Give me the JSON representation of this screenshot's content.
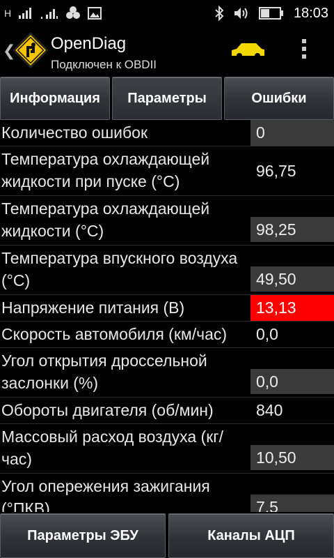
{
  "status_bar": {
    "left_indicator_text": "H",
    "time": "18:03"
  },
  "app_bar": {
    "title": "OpenDiag",
    "subtitle": "Подключен к OBDII",
    "car_color": "#f3d800"
  },
  "tabs": [
    {
      "label": "Информация"
    },
    {
      "label": "Параметры"
    },
    {
      "label": "Ошибки"
    }
  ],
  "params": [
    {
      "label": "Количество ошибок",
      "value": "0"
    },
    {
      "label": "Температура охлаждающей жидкости при пуске (°C)",
      "value": "96,75"
    },
    {
      "label": "Температура охлаждающей жидкости (°C)",
      "value": "98,25"
    },
    {
      "label": "Температура впускного воздуха (°C)",
      "value": "49,50"
    },
    {
      "label": "Напряжение питания (В)",
      "value": "13,13"
    },
    {
      "label": "Скорость автомобиля (км/час)",
      "value": "0,0"
    },
    {
      "label": "Угол открытия дроссельной заслонки (%)",
      "value": "0,0"
    },
    {
      "label": "Обороты двигателя (об/мин)",
      "value": "840"
    },
    {
      "label": "Массовый расход воздуха (кг/час)",
      "value": "10,50"
    },
    {
      "label": "Угол опережения зажигания (°ПКВ)",
      "value": "7,5"
    }
  ],
  "bottom_buttons": [
    {
      "label": "Параметры ЭБУ"
    },
    {
      "label": "Каналы АЦП"
    }
  ],
  "colors": {
    "alert": "#ff0000",
    "value_box": "#3a3a3a"
  }
}
